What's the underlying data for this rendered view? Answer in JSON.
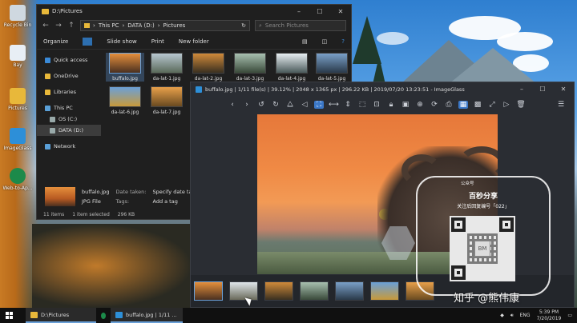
{
  "desktop": {
    "icons": [
      {
        "label": "Recycle Bin",
        "icon": "recycle-bin-icon",
        "color": "#cfd8e0"
      },
      {
        "label": "Bay",
        "icon": "document-icon",
        "color": "#e8eef5"
      },
      {
        "label": "Pictures",
        "icon": "folder-icon",
        "color": "#e8b83a"
      },
      {
        "label": "ImageGlass",
        "icon": "imageglass-icon",
        "color": "#2d8fd8"
      },
      {
        "label": "Web-to-Ap...",
        "icon": "web-app-icon",
        "color": "#1c8a4a"
      }
    ]
  },
  "explorer": {
    "title": "D:\\Pictures",
    "path": [
      "This PC",
      "DATA (D:)",
      "Pictures"
    ],
    "search_placeholder": "Search Pictures",
    "toolbar": [
      "Organize",
      "Slide show",
      "Print",
      "New folder"
    ],
    "nav": {
      "quick_access": "Quick access",
      "onedrive": "OneDrive",
      "libraries": "Libraries",
      "this_pc": "This PC",
      "os_c": "OS (C:)",
      "data_d": "DATA (D:)",
      "network": "Network"
    },
    "files": [
      {
        "name": "buffalo.jpg",
        "colors": [
          "#e58f3c",
          "#4a3020"
        ]
      },
      {
        "name": "da-lat-1.jpg",
        "colors": [
          "#b8c7d0",
          "#5a6a5a"
        ]
      },
      {
        "name": "da-lat-2.jpg",
        "colors": [
          "#d08a3a",
          "#3a3020"
        ]
      },
      {
        "name": "da-lat-3.jpg",
        "colors": [
          "#a8c0b0",
          "#3a4a3a"
        ]
      },
      {
        "name": "da-lat-4.jpg",
        "colors": [
          "#e8eef2",
          "#4a5a5a"
        ]
      },
      {
        "name": "da-lat-5.jpg",
        "colors": [
          "#7aa0c8",
          "#2a3a4a"
        ]
      },
      {
        "name": "da-lat-6.jpg",
        "colors": [
          "#6aa0d8",
          "#c89a3a"
        ]
      },
      {
        "name": "da-lat-7.jpg",
        "colors": [
          "#e8a04a",
          "#6a4a20"
        ]
      }
    ],
    "details": {
      "name": "buffalo.jpg",
      "type": "JPG File",
      "date_label": "Date taken:",
      "date_value": "Specify date taken",
      "tags_label": "Tags:",
      "tags_value": "Add a tag"
    },
    "status": {
      "count": "11 items",
      "selected": "1 item selected",
      "size": "296 KB"
    }
  },
  "imageglass": {
    "title": "buffalo.jpg  |  1/11 file(s)  |  39.12%  |  2048 x 1365 px  |  296.22 KB  |  2019/07/20 13:23:51  -  ImageGlass",
    "toolbar_icons": [
      "prev-icon",
      "next-icon",
      "rotate-left-icon",
      "rotate-right-icon",
      "flip-h-icon",
      "flip-v-icon",
      "zoom-fit-icon",
      "zoom-width-icon",
      "zoom-height-icon",
      "zoom-auto-icon",
      "zoom-scale-icon",
      "lock-zoom-icon",
      "scale-to-fill-icon",
      "zoom-in-icon",
      "refresh-icon",
      "print-icon",
      "gallery-icon",
      "checkerboard-icon",
      "fullscreen-icon",
      "slideshow-icon",
      "delete-icon"
    ],
    "thumb_colors": [
      "#e58f3c",
      "#dfe6ea",
      "#d08a3a",
      "#a8c0b0",
      "#7aa0c8",
      "#6aa0d8",
      "#e8a04a"
    ]
  },
  "qr_overlay": {
    "badge": "公众号",
    "title": "百秒分享",
    "subtitle": "关注后回复编号「022」",
    "logo_text": "BM",
    "watermark": "知乎 @熊伟康"
  },
  "taskbar": {
    "tasks": [
      {
        "label": "D:\\Pictures",
        "icon": "folder-icon",
        "color": "#e8b83a"
      },
      {
        "label": "buffalo.jpg | 1/11 ...",
        "icon": "imageglass-icon",
        "color": "#2d8fd8"
      }
    ],
    "lang": "ENG",
    "time": "5:39 PM",
    "date": "7/20/2019"
  }
}
